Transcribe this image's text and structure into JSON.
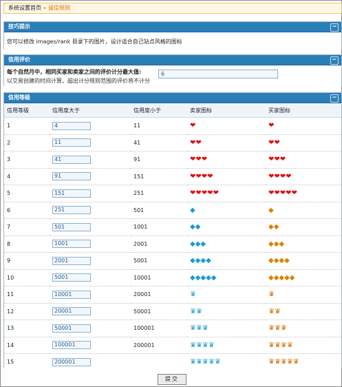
{
  "breadcrumb": {
    "home": "系统设置首页",
    "sep": "»",
    "current": "诚信规则"
  },
  "tips": {
    "title": "技巧提示",
    "text": "您可以修改 images/rank 目录下的图片，设计适合自己站点风格的图标"
  },
  "credit": {
    "title": "信用评价",
    "question": "每个自然月中，相同买家和卖家之间的评价计分最大值:",
    "hint": "以交易创建的时间计算，超出计分规则范围的评价将不计分",
    "value": "6"
  },
  "levels": {
    "title": "信用等级",
    "headers": [
      "信用等级",
      "信用度大于",
      "信用度小于",
      "卖家图标",
      "买家图标"
    ],
    "rows": [
      {
        "level": "1",
        "gt": "4",
        "lt": "11",
        "seller": "❤",
        "buyer": "❤",
        "stype": "heart",
        "btype": "heart"
      },
      {
        "level": "2",
        "gt": "11",
        "lt": "41",
        "seller": "❤❤",
        "buyer": "❤❤",
        "stype": "heart",
        "btype": "heart"
      },
      {
        "level": "3",
        "gt": "41",
        "lt": "91",
        "seller": "❤❤❤",
        "buyer": "❤❤❤",
        "stype": "heart",
        "btype": "heart"
      },
      {
        "level": "4",
        "gt": "91",
        "lt": "151",
        "seller": "❤❤❤❤",
        "buyer": "❤❤❤❤",
        "stype": "heart",
        "btype": "heart"
      },
      {
        "level": "5",
        "gt": "151",
        "lt": "251",
        "seller": "❤❤❤❤❤",
        "buyer": "❤❤❤❤❤",
        "stype": "heart",
        "btype": "heart"
      },
      {
        "level": "6",
        "gt": "251",
        "lt": "501",
        "seller": "◆",
        "buyer": "◆",
        "stype": "gem",
        "btype": "crown"
      },
      {
        "level": "7",
        "gt": "501",
        "lt": "1001",
        "seller": "◆◆",
        "buyer": "◆◆",
        "stype": "gem",
        "btype": "crown"
      },
      {
        "level": "8",
        "gt": "1001",
        "lt": "2001",
        "seller": "◆◆◆",
        "buyer": "◆◆◆",
        "stype": "gem",
        "btype": "crown"
      },
      {
        "level": "9",
        "gt": "2001",
        "lt": "5001",
        "seller": "◆◆◆◆",
        "buyer": "◆◆◆◆",
        "stype": "gem",
        "btype": "crown"
      },
      {
        "level": "10",
        "gt": "5001",
        "lt": "10001",
        "seller": "◆◆◆◆◆",
        "buyer": "◆◆◆◆◆",
        "stype": "gem",
        "btype": "crown"
      },
      {
        "level": "11",
        "gt": "10001",
        "lt": "20001",
        "seller": "♛",
        "buyer": "♛",
        "stype": "gem",
        "btype": "crown2"
      },
      {
        "level": "12",
        "gt": "20001",
        "lt": "50001",
        "seller": "♛♛",
        "buyer": "♛♛",
        "stype": "gem",
        "btype": "crown2"
      },
      {
        "level": "13",
        "gt": "50001",
        "lt": "100001",
        "seller": "♛♛♛",
        "buyer": "♛♛♛",
        "stype": "gem",
        "btype": "crown2"
      },
      {
        "level": "14",
        "gt": "100001",
        "lt": "200001",
        "seller": "♛♛♛♛",
        "buyer": "♛♛♛♛",
        "stype": "gem",
        "btype": "crown2"
      },
      {
        "level": "15",
        "gt": "200001",
        "lt": "",
        "seller": "♛♛♛♛♛",
        "buyer": "♛♛♛♛♛",
        "stype": "gem",
        "btype": "crown2"
      }
    ]
  },
  "submit_label": "提交",
  "colors": {
    "panel_header": "#2b7fb8",
    "heart": "#e01010",
    "gem": "#1a9ad8",
    "crown": "#e08000"
  }
}
